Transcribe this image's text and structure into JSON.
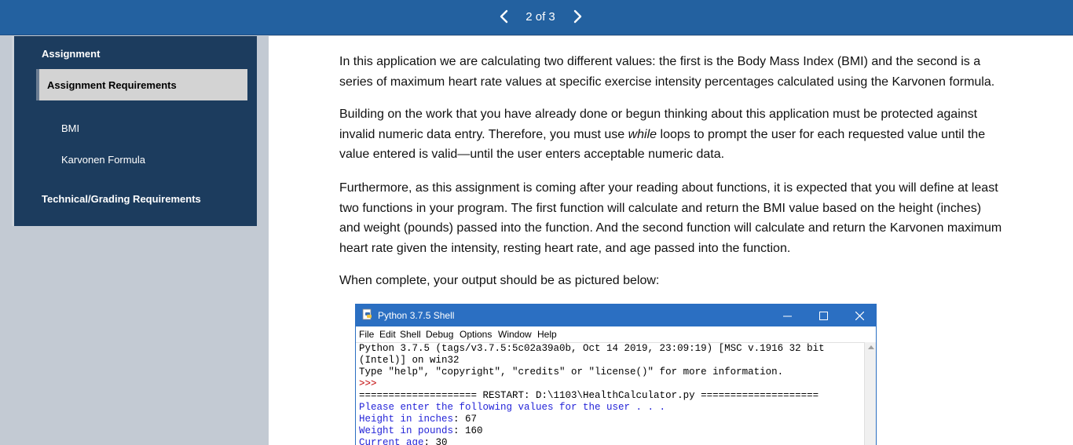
{
  "topbar": {
    "page_indicator": "2 of 3",
    "prev_icon": "chevron-left-icon",
    "next_icon": "chevron-right-icon"
  },
  "sidebar": {
    "items": [
      {
        "label": "Assignment"
      },
      {
        "label": "Assignment Requirements",
        "active": true
      },
      {
        "label": "BMI"
      },
      {
        "label": "Karvonen Formula"
      },
      {
        "label": "Technical/Grading Requirements"
      }
    ]
  },
  "content": {
    "p1": "In this application we are calculating two different values: the first is the Body Mass Index (BMI) and the second is a series of maximum heart rate values at specific exercise intensity percentages calculated using the Karvonen formula.",
    "p2_before": "Building on the work that you have already done or begun thinking about this application must be protected against invalid numeric data entry. Therefore, you must use ",
    "p2_em": "while",
    "p2_after": " loops to prompt the user for each requested value until the value entered is valid—until the user enters acceptable numeric data.",
    "p3": "Furthermore, as this assignment is coming after your reading about functions, it is expected that you will define at least two functions in your program. The first function will calculate and return the BMI value based on the height (inches) and weight (pounds) passed into the function. And the second function will calculate and return the Karvonen maximum heart rate given the intensity, resting heart rate, and age passed into the function.",
    "p4": "When complete, your output should be as pictured below:"
  },
  "shell": {
    "title": "Python 3.7.5 Shell",
    "menu": [
      "File",
      "Edit",
      "Shell",
      "Debug",
      "Options",
      "Window",
      "Help"
    ],
    "lines": {
      "l1": "Python 3.7.5 (tags/v3.7.5:5c02a39a0b, Oct 14 2019, 23:09:19) [MSC v.1916 32 bit",
      "l2": "(Intel)] on win32",
      "l3": "Type \"help\", \"copyright\", \"credits\" or \"license()\" for more information.",
      "l4": ">>>",
      "l5": "==================== RESTART: D:\\1103\\HealthCalculator.py ====================",
      "l6": "Please enter the following values for the user . . .",
      "l7_label": "Height in inches",
      "l7_value": ": 67",
      "l8_label": "Weight in pounds",
      "l8_value": ": 160",
      "l9_label": "Current age",
      "l9_value": ": 30"
    },
    "colors": {
      "titlebar": "#2b6fc2",
      "prompt_blue": "#2424d8",
      "prompt_red": "#c00000"
    }
  },
  "colors": {
    "topbar": "#2361a0",
    "toc_bg": "#1c3c5e",
    "active_item_bg": "#d3d3d3"
  }
}
